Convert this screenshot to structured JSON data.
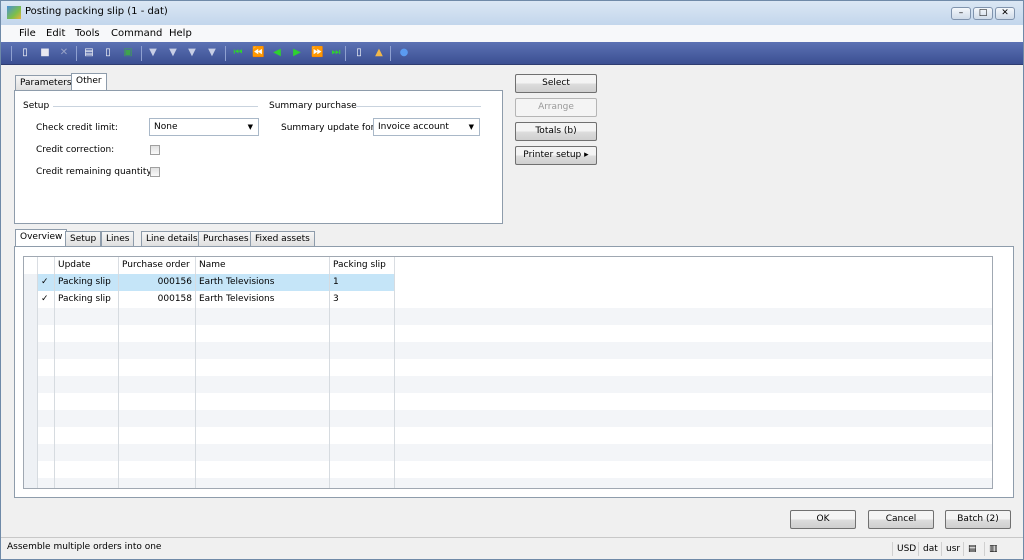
{
  "window": {
    "title": "Posting packing slip (1 - dat)"
  },
  "menu": [
    "File",
    "Edit",
    "Tools",
    "Command",
    "Help"
  ],
  "toolbar": [
    "new-icon",
    "save-icon",
    "delete-icon",
    "print-icon",
    "print-preview-icon",
    "excel-icon",
    "filter-by-selection-icon",
    "filter-by-grid-icon",
    "advanced-filter-icon",
    "remove-filter-icon",
    "first-record-icon",
    "previous-page-icon",
    "previous-record-icon",
    "next-record-icon",
    "next-page-icon",
    "last-record-icon",
    "document-handling-icon",
    "alert-icon",
    "help-icon"
  ],
  "top_tabs": [
    "Parameters",
    "Other"
  ],
  "setup": {
    "heading": "Setup",
    "check_credit_limit_label": "Check credit limit:",
    "check_credit_limit_value": "None",
    "credit_correction_label": "Credit correction:",
    "credit_correction_checked": false,
    "credit_remaining_label": "Credit remaining quantity:",
    "credit_remaining_checked": false
  },
  "summary": {
    "heading": "Summary purchase",
    "update_for_label": "Summary update for:",
    "update_for_value": "Invoice account"
  },
  "side_buttons": {
    "select": "Select",
    "arrange": "Arrange",
    "totals": "Totals (b)",
    "printer_setup": "Printer setup"
  },
  "bottom_tabs": [
    "Overview",
    "Setup",
    "Lines",
    "Line details",
    "Purchases",
    "Fixed assets"
  ],
  "grid": {
    "columns": [
      "Update",
      "Purchase order",
      "Name",
      "Packing slip"
    ],
    "rows": [
      {
        "checked": true,
        "update": "Packing slip",
        "purchase_order": "000156",
        "name": "Earth Televisions",
        "packing_slip": "1",
        "selected": true
      },
      {
        "checked": true,
        "update": "Packing slip",
        "purchase_order": "000158",
        "name": "Earth Televisions",
        "packing_slip": "3",
        "selected": false
      }
    ]
  },
  "buttons": {
    "ok": "OK",
    "cancel": "Cancel",
    "batch": "Batch (2)"
  },
  "status": {
    "message": "Assemble multiple orders into one",
    "currency": "USD",
    "company": "dat",
    "user": "usr"
  },
  "colors": {
    "toolbar": "#3b4f92",
    "selected_row": "#c5e5f8",
    "stripe": "#f3f5f8"
  }
}
